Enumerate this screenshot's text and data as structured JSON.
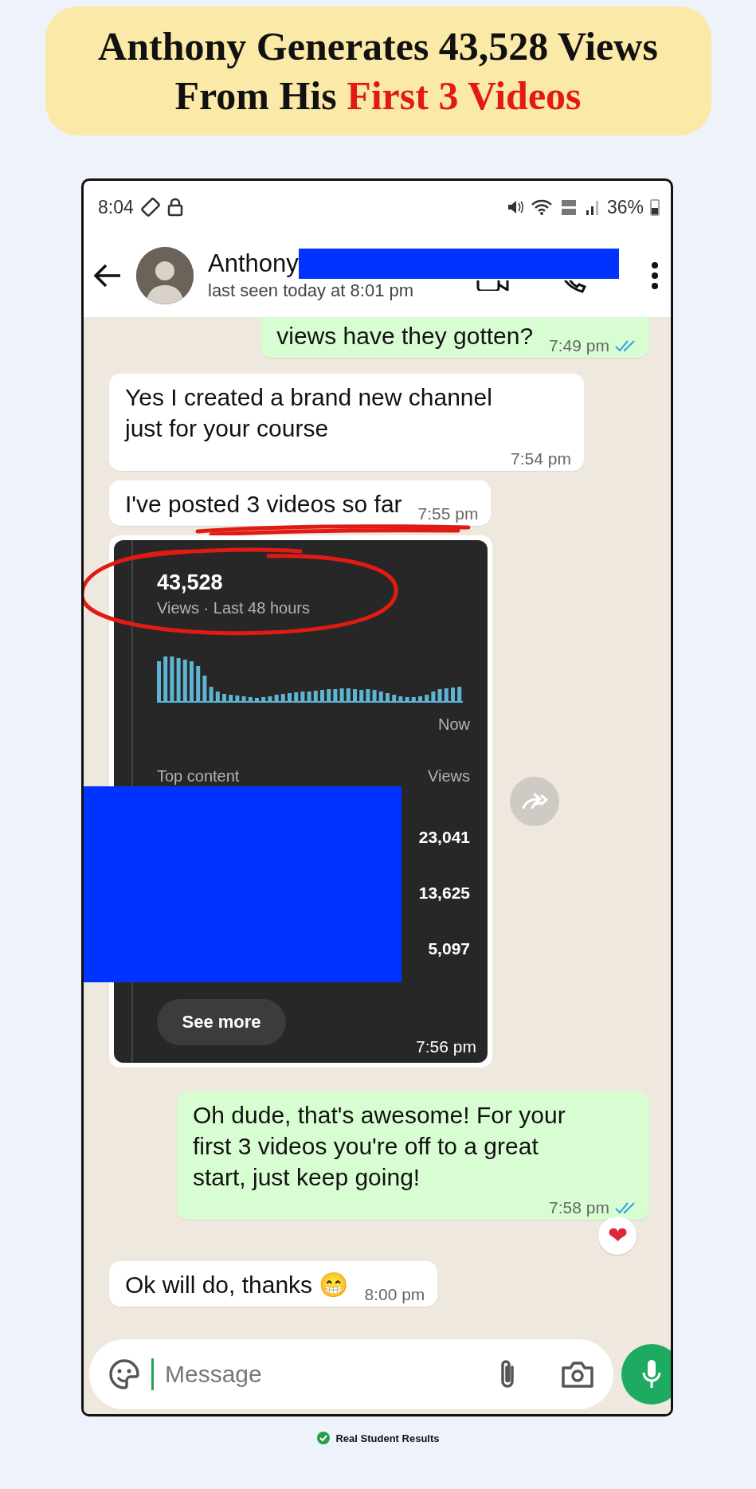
{
  "headline": {
    "lines": [
      [
        {
          "text": "Anthony Generates 43,528 Views",
          "highlight": false
        }
      ],
      [
        {
          "text": "From His ",
          "highlight": false
        },
        {
          "text": "First 3 Videos",
          "highlight": true
        }
      ]
    ]
  },
  "status_bar": {
    "time": "8:04",
    "battery": "36%"
  },
  "chat_header": {
    "contact_name": "Anthony",
    "last_seen": "last seen today at 8:01 pm"
  },
  "messages": [
    {
      "kind": "outgoing",
      "text": "views have they gotten?",
      "time": "7:49 pm",
      "read": true
    },
    {
      "kind": "incoming",
      "text": "Yes I created a brand new channel just for your course",
      "time": "7:54 pm"
    },
    {
      "kind": "incoming",
      "text": "I've posted 3 videos so far",
      "time": "7:55 pm",
      "underlined": true
    },
    {
      "kind": "image",
      "time": "7:56 pm",
      "card": {
        "total_views": "43,528",
        "caption": "Views · Last 48 hours",
        "circled": true,
        "axis_label": "Now",
        "top_content_heading": "Top content",
        "views_heading": "Views",
        "top_views": [
          "23,041",
          "13,625",
          "5,097"
        ],
        "button": "See more"
      }
    },
    {
      "kind": "outgoing",
      "text": "Oh dude, that's awesome! For your first 3 videos you're off to a great start, just keep going!",
      "time": "7:58 pm",
      "read": true,
      "reaction": "❤"
    },
    {
      "kind": "incoming",
      "text": "Ok will do, thanks 😁",
      "time": "8:00 pm"
    }
  ],
  "composer": {
    "placeholder": "Message"
  },
  "footer": {
    "label": "Real Student Results"
  }
}
